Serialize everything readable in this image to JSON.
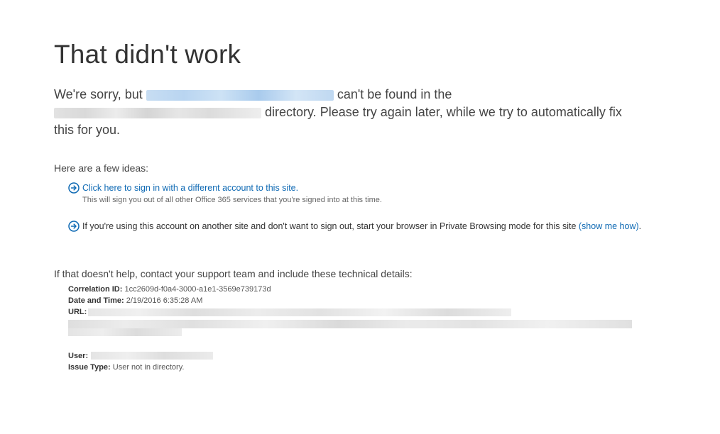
{
  "page": {
    "title": "That didn't work",
    "message": {
      "part1": "We're sorry, but ",
      "part2": " can't be found in the ",
      "part3": " directory. Please try again later, while we try to automatically fix this for you."
    },
    "ideas_heading": "Here are a few ideas:",
    "ideas": [
      {
        "link": "Click here to sign in with a different account to this site.",
        "sub": "This will sign you out of all other Office 365 services that you're signed into at this time."
      },
      {
        "text": "If you're using this account on another site and don't want to sign out, start your browser in Private Browsing mode for this site ",
        "link": "(show me how)",
        "suffix": "."
      }
    ],
    "help_heading": "If that doesn't help, contact your support team and include these technical details:",
    "details": {
      "correlation_label": "Correlation ID:",
      "correlation_value": "1cc2609d-f0a4-3000-a1e1-3569e739173d",
      "datetime_label": "Date and Time:",
      "datetime_value": "2/19/2016 6:35:28 AM",
      "url_label": "URL:",
      "user_label": "User:",
      "issue_label": "Issue Type:",
      "issue_value": "User not in directory."
    }
  },
  "colors": {
    "link": "#0f6ab4",
    "text": "#333333",
    "background": "#ffffff"
  },
  "icons": {
    "idea_bullet": "circle-arrow-right-icon"
  }
}
